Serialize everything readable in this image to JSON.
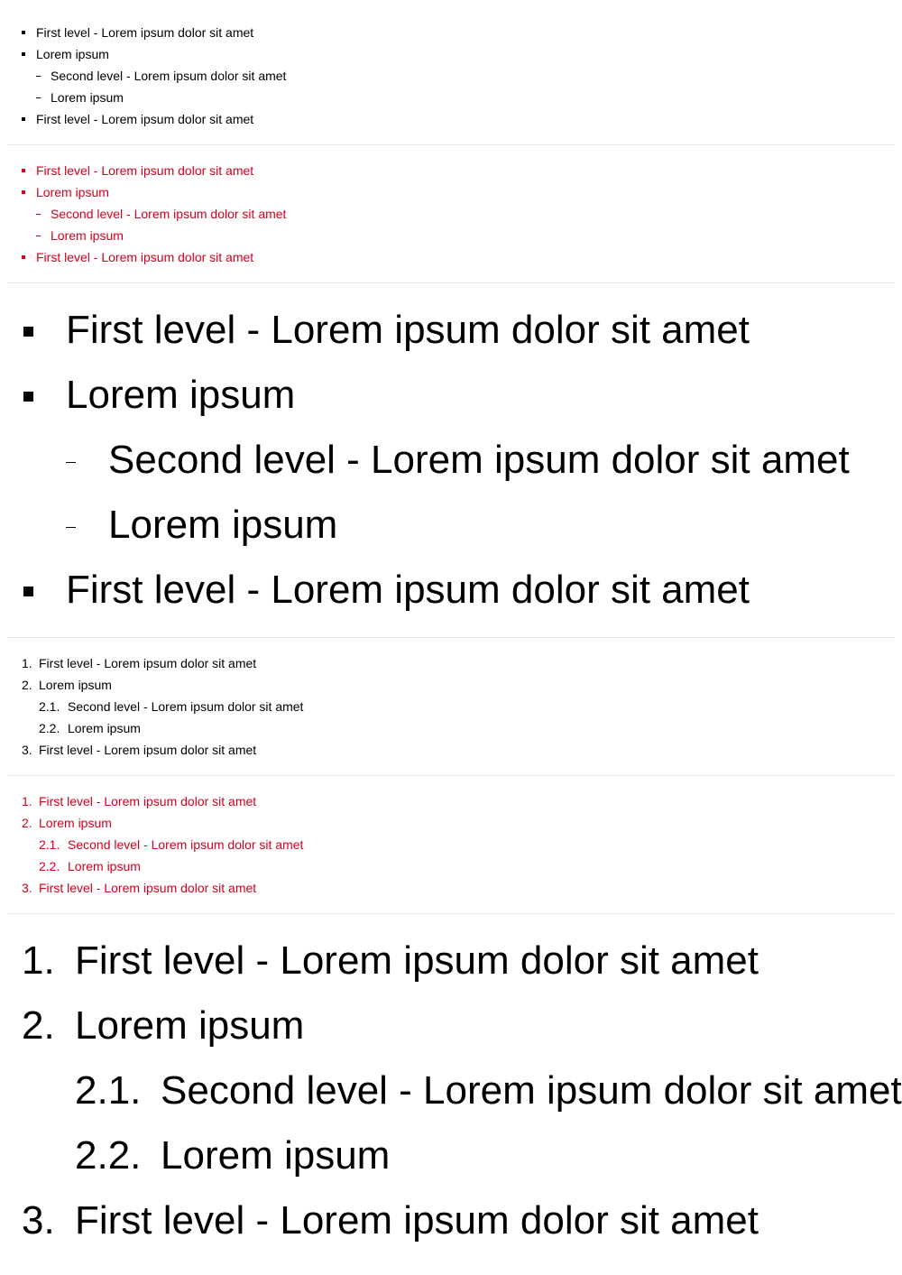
{
  "colors": {
    "text": "#000000",
    "accent": "#d5001c",
    "divider": "#e6e6e6"
  },
  "unordered_small": {
    "items": [
      {
        "label": "First level - Lorem ipsum dolor sit amet"
      },
      {
        "label": "Lorem ipsum"
      },
      {
        "label": "Second level - Lorem ipsum dolor sit amet"
      },
      {
        "label": "Lorem ipsum"
      },
      {
        "label": "First level - Lorem ipsum dolor sit amet"
      }
    ]
  },
  "unordered_small_red": {
    "items": [
      {
        "label": "First level - Lorem ipsum dolor sit amet"
      },
      {
        "label": "Lorem ipsum"
      },
      {
        "label": "Second level - Lorem ipsum dolor sit amet"
      },
      {
        "label": "Lorem ipsum"
      },
      {
        "label": "First level - Lorem ipsum dolor sit amet"
      }
    ]
  },
  "unordered_large": {
    "items": [
      {
        "label": "First level - Lorem ipsum dolor sit amet"
      },
      {
        "label": "Lorem ipsum"
      },
      {
        "label": "Second level - Lorem ipsum dolor sit amet"
      },
      {
        "label": "Lorem ipsum"
      },
      {
        "label": "First level - Lorem ipsum dolor sit amet"
      }
    ]
  },
  "ordered_small": {
    "items": [
      {
        "number": "1.",
        "label": "First level - Lorem ipsum dolor sit amet"
      },
      {
        "number": "2.",
        "label": "Lorem ipsum"
      },
      {
        "number": "2.1.",
        "label": "Second level - Lorem ipsum dolor sit amet"
      },
      {
        "number": "2.2.",
        "label": "Lorem ipsum"
      },
      {
        "number": "3.",
        "label": "First level - Lorem ipsum dolor sit amet"
      }
    ]
  },
  "ordered_small_red": {
    "items": [
      {
        "number": "1.",
        "label": "First level - Lorem ipsum dolor sit amet"
      },
      {
        "number": "2.",
        "label": "Lorem ipsum"
      },
      {
        "number": "2.1.",
        "label": "Second level - Lorem ipsum dolor sit amet"
      },
      {
        "number": "2.2.",
        "label": "Lorem ipsum"
      },
      {
        "number": "3.",
        "label": "First level - Lorem ipsum dolor sit amet"
      }
    ]
  },
  "ordered_large": {
    "items": [
      {
        "number": "1.",
        "label": "First level - Lorem ipsum dolor sit amet"
      },
      {
        "number": "2.",
        "label": "Lorem ipsum"
      },
      {
        "number": "2.1.",
        "label": "Second level - Lorem ipsum dolor sit amet"
      },
      {
        "number": "2.2.",
        "label": "Lorem ipsum"
      },
      {
        "number": "3.",
        "label": "First level - Lorem ipsum dolor sit amet"
      }
    ]
  }
}
